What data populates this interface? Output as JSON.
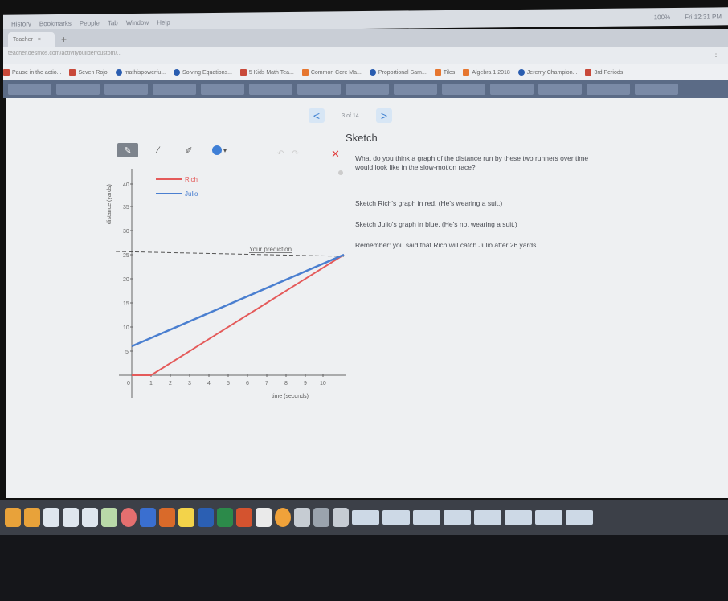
{
  "browser": {
    "menu_items": [
      "History",
      "Bookmarks",
      "People",
      "Tab",
      "Window",
      "Help"
    ],
    "status_right": "100%",
    "clock": "Fri 12:31 PM",
    "tab_label": "Teacher",
    "url": "teacher.desmos.com/activitybuilder/custom/...",
    "bookmarks": [
      "Pause in the actio...",
      "Seven Rojo",
      "mathispowerfu...",
      "Solving Equations...",
      "5 Kids Math Tea...",
      "Common Core Ma...",
      "Proportional Sam...",
      "Tiles",
      "Algebra 1 2018",
      "Jeremy Champion...",
      "3rd Periods"
    ]
  },
  "nav": {
    "prev": "<",
    "next": ">",
    "page": "3 of 14"
  },
  "panel": {
    "title": "Sketch",
    "question": "What do you think a graph of the distance run by these two runners over time would look like in the slow-motion race?",
    "line1": "Sketch Rich's graph in red. (He's wearing a suit.)",
    "line2": "Sketch Julio's graph in blue. (He's not wearing a suit.)",
    "line3": "Remember: you said that Rich will catch Julio after 26 yards."
  },
  "graph": {
    "ylabel": "distance (yards)",
    "xlabel": "time (seconds)",
    "legend": [
      "Rich",
      "Julio"
    ],
    "prediction_label": "Your prediction",
    "y_ticks": [
      "5",
      "10",
      "15",
      "20",
      "25",
      "30",
      "35",
      "40"
    ],
    "x_ticks": [
      "1",
      "2",
      "3",
      "4",
      "5",
      "6",
      "7",
      "8",
      "9",
      "10"
    ],
    "origin": "0"
  },
  "colors": {
    "rich": "#e45a5a",
    "julio": "#4a7fd0",
    "accent": "#3f7fd6"
  }
}
